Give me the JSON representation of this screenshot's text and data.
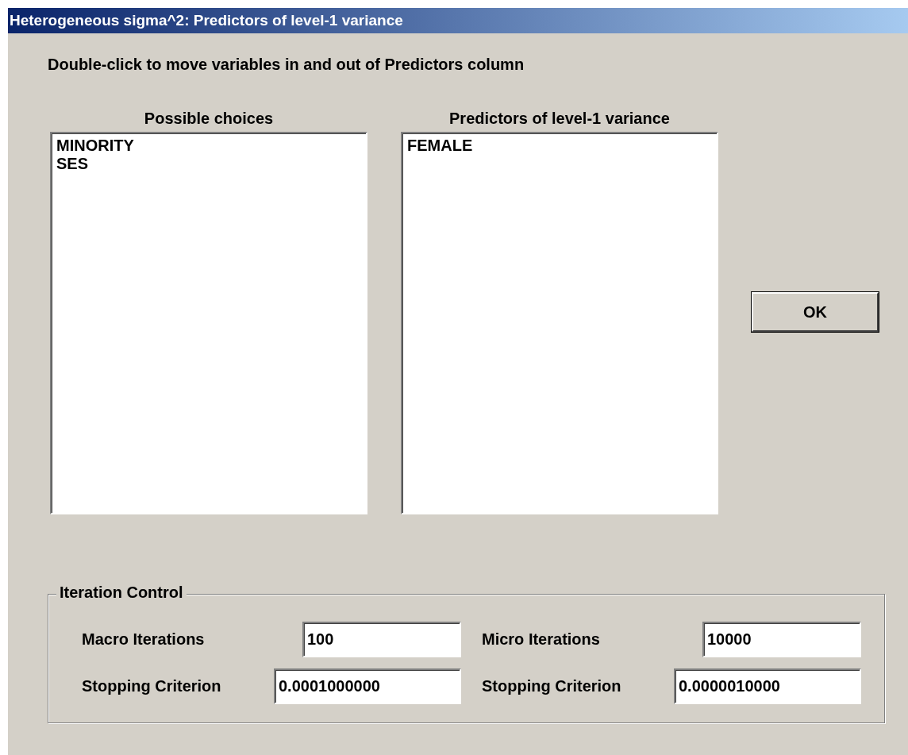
{
  "window": {
    "title": "Heterogeneous sigma^2: Predictors of level-1 variance"
  },
  "instruction": "Double-click to move variables in and out of Predictors column",
  "lists": [
    {
      "label": "Possible choices",
      "items": [
        "MINORITY",
        "SES"
      ]
    },
    {
      "label": "Predictors of level-1 variance",
      "items": [
        "FEMALE"
      ]
    }
  ],
  "ok_button": "OK",
  "iteration_control": {
    "title": "Iteration Control",
    "rows": [
      [
        {
          "label": "Macro Iterations",
          "value": "100"
        },
        {
          "label": "Micro Iterations",
          "value": "10000"
        }
      ],
      [
        {
          "label": "Stopping Criterion",
          "value": "0.0001000000"
        },
        {
          "label": "Stopping Criterion",
          "value": "0.0000010000"
        }
      ]
    ]
  }
}
